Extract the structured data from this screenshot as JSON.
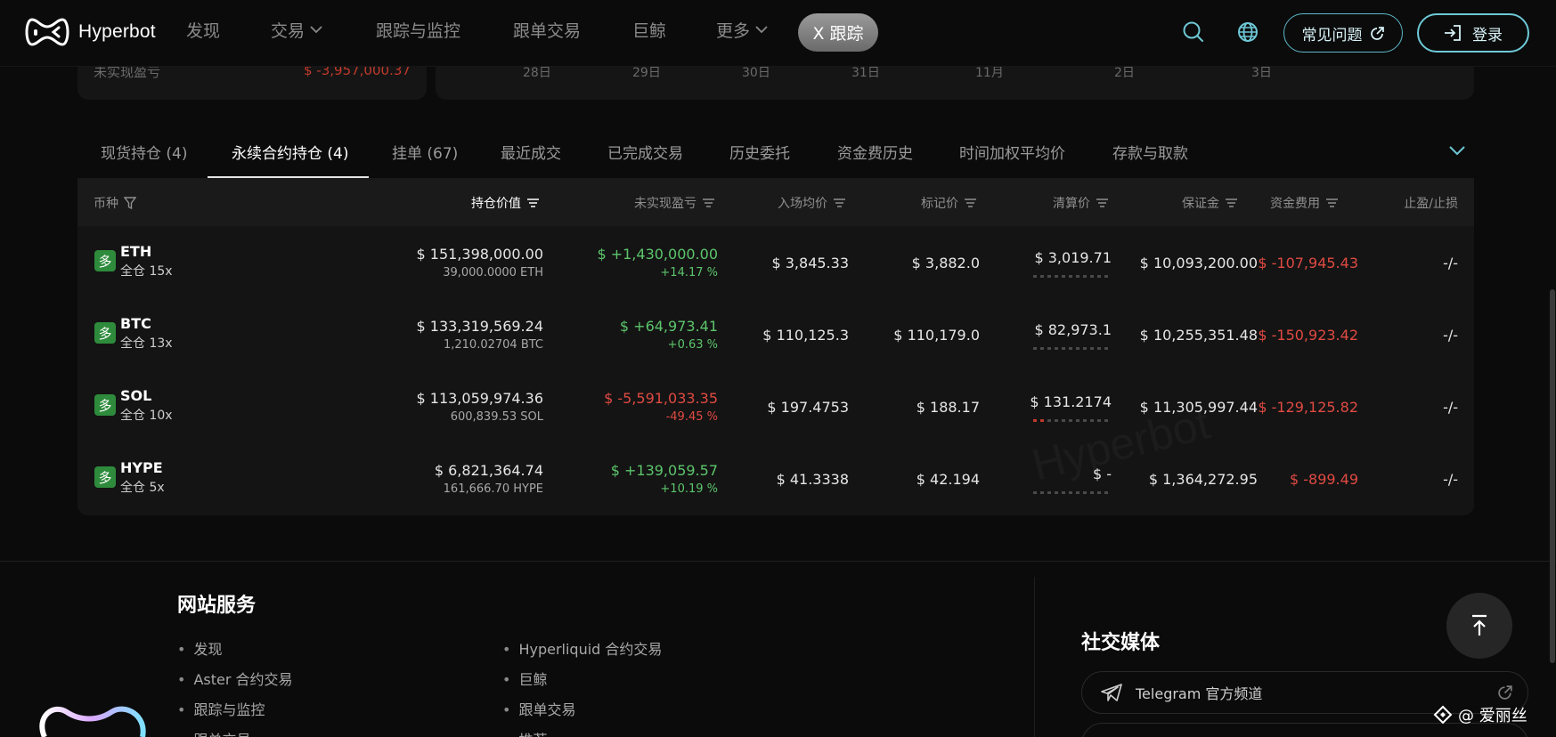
{
  "header": {
    "logo_text": "Hyperbot",
    "nav": [
      "发现",
      "交易",
      "跟踪与监控",
      "跟单交易",
      "巨鲸",
      "更多"
    ],
    "x_track_label": "X 跟踪",
    "faq_label": "常见问题",
    "login_label": "登录"
  },
  "stats": {
    "unrealized_label": "未实现盈亏",
    "unrealized_value": "$ -3,957,000.37",
    "date_ticks": [
      "28日",
      "29日",
      "30日",
      "31日",
      "11月",
      "2日",
      "3日"
    ]
  },
  "tabs": [
    "现货持仓 (4)",
    "永续合约持仓 (4)",
    "挂单 (67)",
    "最近成交",
    "已完成交易",
    "历史委托",
    "资金费历史",
    "时间加权平均价",
    "存款与取款"
  ],
  "table": {
    "columns": [
      "币种",
      "持仓价值",
      "未实现盈亏",
      "入场均价",
      "标记价",
      "清算价",
      "保证金",
      "资金费用",
      "止盈/止损"
    ],
    "side_badge": "多",
    "rows": [
      {
        "symbol": "ETH",
        "leverage": "全仓 15x",
        "value": "$ 151,398,000.00",
        "size": "39,000.0000 ETH",
        "pnl": "$ +1,430,000.00",
        "pnl_pct": "+14.17 %",
        "pnl_sign": "pos",
        "entry": "$ 3,845.33",
        "mark": "$ 3,882.0",
        "liq": "$ 3,019.71",
        "margin": "$ 10,093,200.00",
        "funding": "$ -107,945.43",
        "tpsl": "-/-"
      },
      {
        "symbol": "BTC",
        "leverage": "全仓 13x",
        "value": "$ 133,319,569.24",
        "size": "1,210.02704 BTC",
        "pnl": "$ +64,973.41",
        "pnl_pct": "+0.63 %",
        "pnl_sign": "pos",
        "entry": "$ 110,125.3",
        "mark": "$ 110,179.0",
        "liq": "$ 82,973.1",
        "margin": "$ 10,255,351.48",
        "funding": "$ -150,923.42",
        "tpsl": "-/-"
      },
      {
        "symbol": "SOL",
        "leverage": "全仓 10x",
        "value": "$ 113,059,974.36",
        "size": "600,839.53 SOL",
        "pnl": "$ -5,591,033.35",
        "pnl_pct": "-49.45 %",
        "pnl_sign": "neg",
        "entry": "$ 197.4753",
        "mark": "$ 188.17",
        "liq": "$ 131.2174",
        "margin": "$ 11,305,997.44",
        "funding": "$ -129,125.82",
        "tpsl": "-/-"
      },
      {
        "symbol": "HYPE",
        "leverage": "全仓 5x",
        "value": "$ 6,821,364.74",
        "size": "161,666.70 HYPE",
        "pnl": "$ +139,059.57",
        "pnl_pct": "+10.19 %",
        "pnl_sign": "pos",
        "entry": "$ 41.3338",
        "mark": "$ 42.194",
        "liq": "$ -",
        "margin": "$ 1,364,272.95",
        "funding": "$ -899.49",
        "tpsl": "-/-"
      }
    ],
    "watermark": "Hyperbot"
  },
  "footer": {
    "title": "网站服务",
    "col1": [
      "发现",
      "Aster 合约交易",
      "跟踪与监控",
      "跟单交易"
    ],
    "col2": [
      "Hyperliquid 合约交易",
      "巨鲸",
      "跟单交易",
      "推荐"
    ],
    "social_title": "社交媒体",
    "social_telegram": "Telegram 官方频道",
    "corner_mark": "@ 爱丽丝"
  },
  "colors": {
    "positive": "#5cc56b",
    "negative": "#e04a42",
    "accent": "#6ec8d6",
    "badge": "#2e8b3c"
  }
}
